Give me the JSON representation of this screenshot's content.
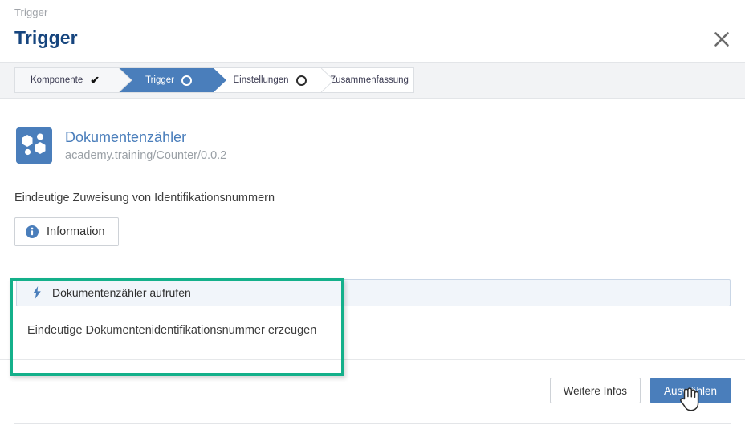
{
  "header": {
    "breadcrumb": "Trigger",
    "title": "Trigger",
    "close_label": "×"
  },
  "stepper": {
    "steps": [
      {
        "label": "Komponente",
        "state": "done",
        "icon": "check-icon"
      },
      {
        "label": "Trigger",
        "state": "current",
        "icon": "circle-icon"
      },
      {
        "label": "Einstellungen",
        "state": "todo",
        "icon": "circle-icon"
      },
      {
        "label": "Zusammenfassung",
        "state": "todo",
        "icon": "none"
      }
    ]
  },
  "component": {
    "icon": "component-hexagons-icon",
    "title": "Dokumentenzähler",
    "identifier": "academy.training/Counter/0.0.2",
    "description": "Eindeutige Zuweisung von Identifikationsnummern",
    "info_button": "Information",
    "info_icon": "info-icon"
  },
  "triggers": {
    "items": [
      {
        "label": "Dokumentenzähler aufrufen",
        "icon": "lightning-bolt-icon",
        "selected": true
      }
    ],
    "selected_description": "Eindeutige Dokumentenidentifikationsnummer erzeugen"
  },
  "footer": {
    "more_info_label": "Weitere Infos",
    "select_label": "Auswählen"
  },
  "colors": {
    "accent_blue": "#4a7ebb",
    "title_blue": "#16457e",
    "highlight_green": "#14b08a",
    "row_selected_bg": "#f1f5fa",
    "stepper_bg": "#f2f3f5"
  }
}
